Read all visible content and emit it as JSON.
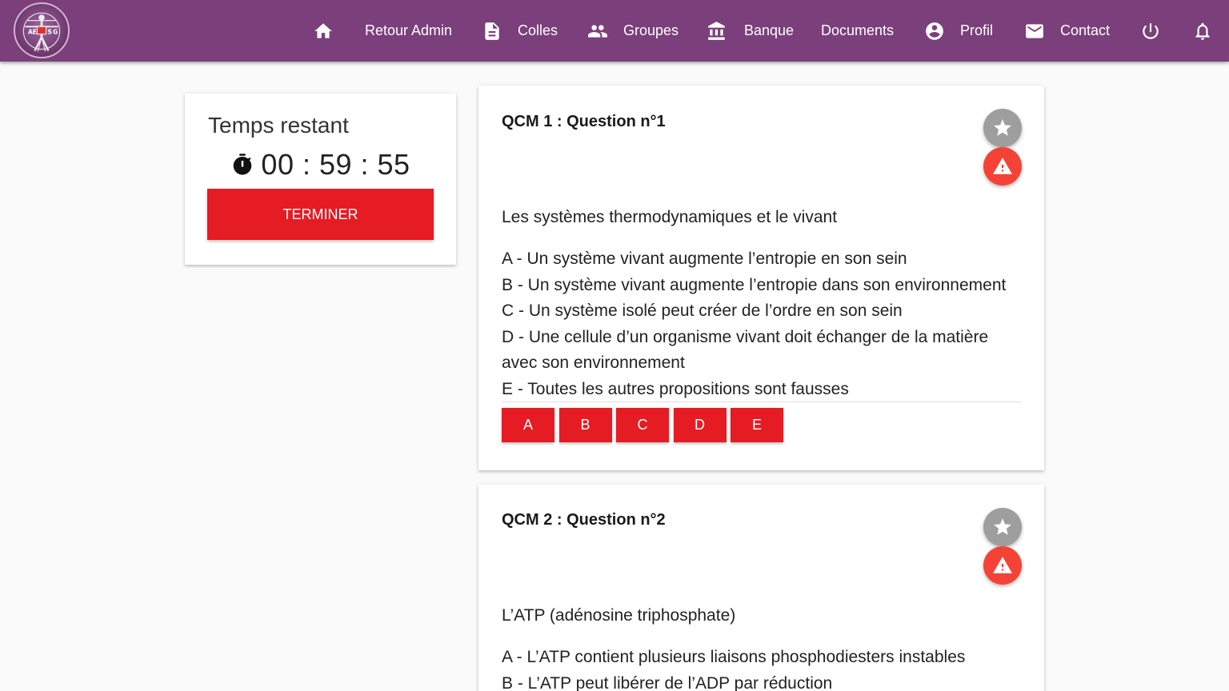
{
  "nav": {
    "items": [
      {
        "icon": "home-icon",
        "label": ""
      },
      {
        "icon": "none",
        "label": "Retour Admin"
      },
      {
        "icon": "document-icon",
        "label": "Colles"
      },
      {
        "icon": "group-icon",
        "label": "Groupes"
      },
      {
        "icon": "bank-icon",
        "label": "Banque"
      },
      {
        "icon": "none",
        "label": "Documents"
      },
      {
        "icon": "account-circle-icon",
        "label": "Profil"
      },
      {
        "icon": "mail-icon",
        "label": "Contact"
      },
      {
        "icon": "power-icon",
        "label": ""
      },
      {
        "icon": "bell-icon",
        "label": ""
      }
    ],
    "background": "#7b3f7b"
  },
  "timer": {
    "title": "Temps restant",
    "value": "00 : 59 : 55",
    "finish_label": "TERMINER"
  },
  "questions": [
    {
      "title": "QCM 1 : Question n°1",
      "subject": "Les systèmes thermodynamiques et le vivant",
      "choices": [
        "A - Un système vivant augmente l’entropie en son sein",
        "B - Un système vivant augmente l’entropie dans son environnement",
        "C - Un système isolé peut créer de l’ordre en son sein",
        "D - Une cellule d’un organisme vivant doit échanger de la matière avec son environnement",
        "E - Toutes les autres propositions sont fausses"
      ],
      "answers": [
        "A",
        "B",
        "C",
        "D",
        "E"
      ]
    },
    {
      "title": "QCM 2 : Question n°2",
      "subject": "L’ATP (adénosine triphosphate)",
      "choices": [
        "A - L’ATP contient plusieurs liaisons phosphodiesters instables",
        "B - L’ATP peut libérer de l’ADP par réduction"
      ]
    }
  ],
  "colors": {
    "accent_red": "#e51c23",
    "fab_grey": "#9e9e9e",
    "fab_red": "#f44336"
  }
}
